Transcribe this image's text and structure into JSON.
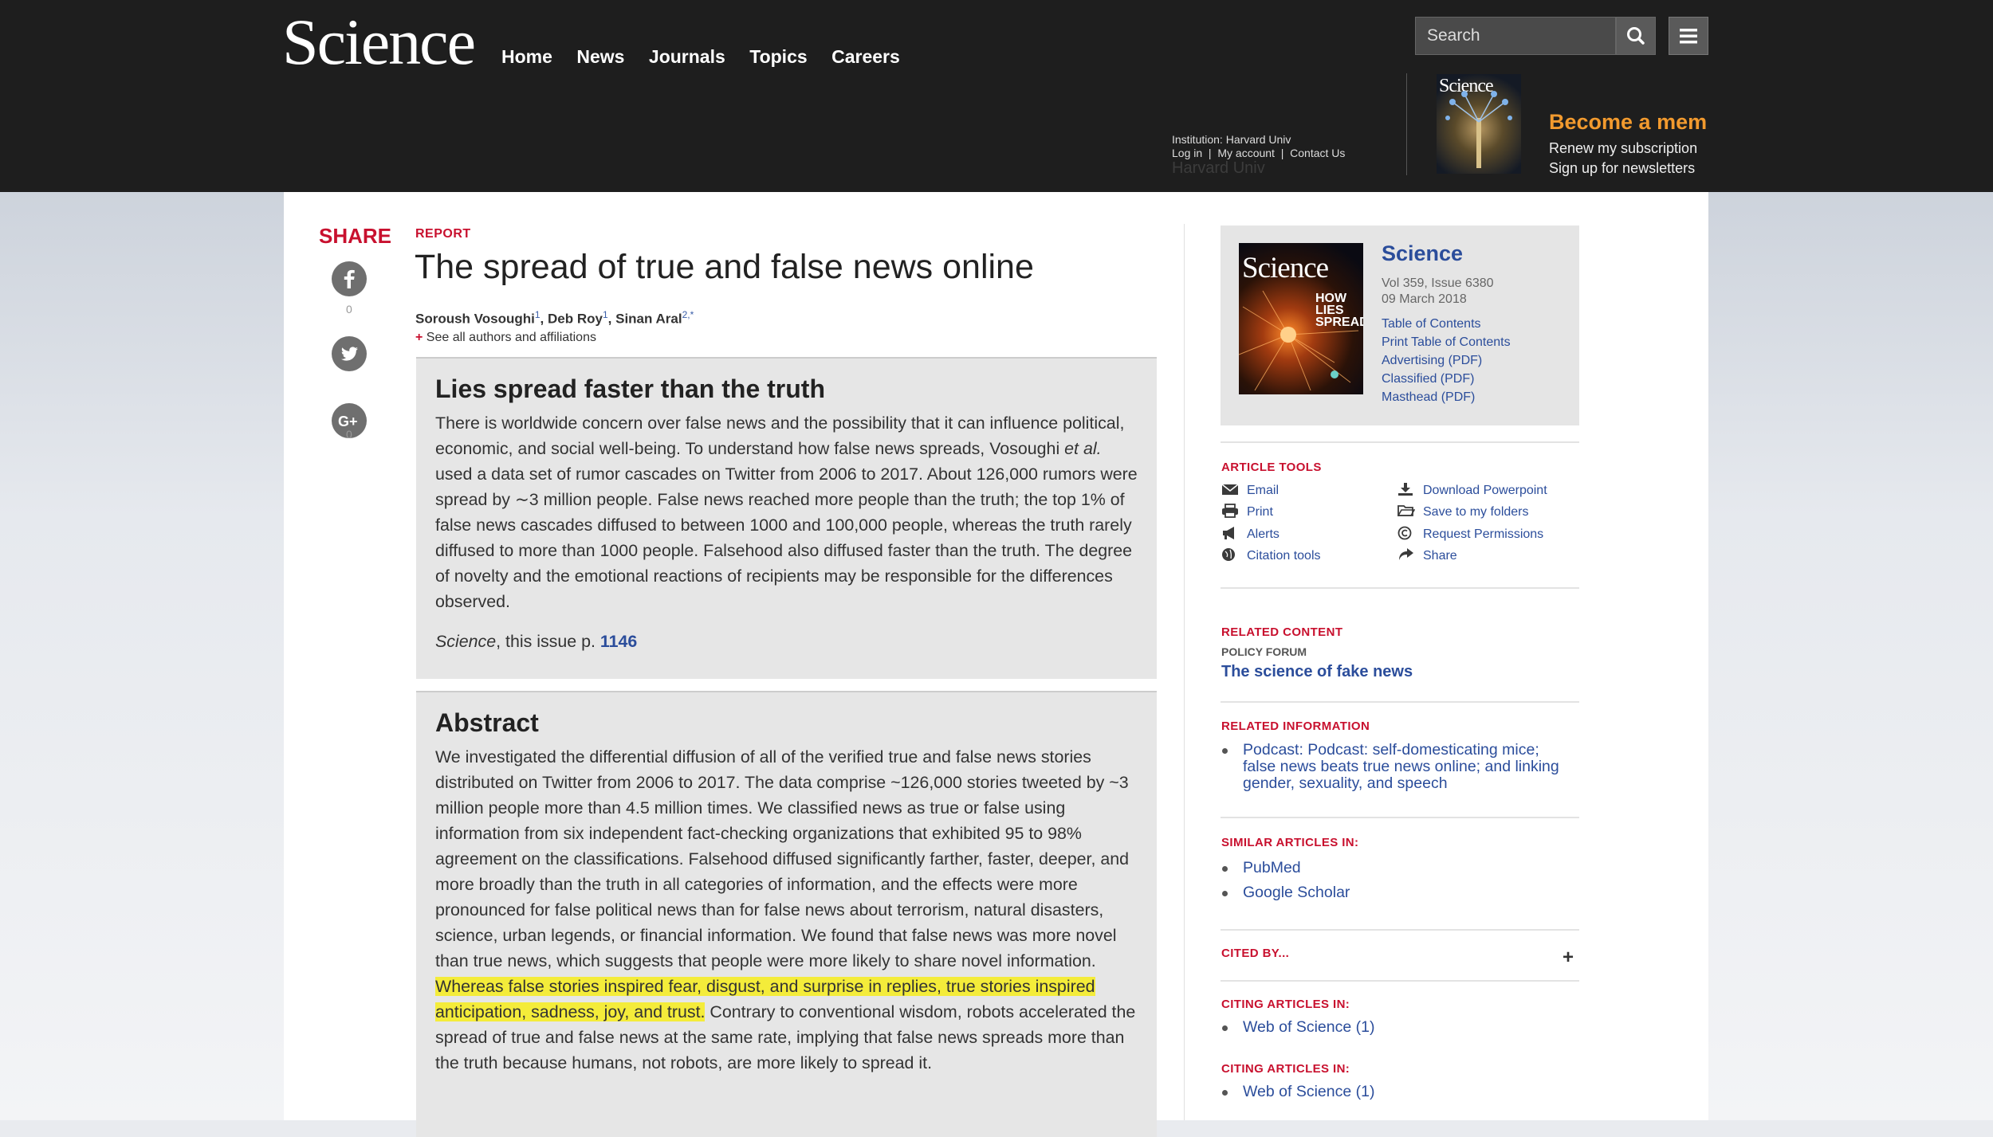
{
  "header": {
    "logo": "Science",
    "nav": [
      "Home",
      "News",
      "Journals",
      "Topics",
      "Careers"
    ],
    "search_placeholder": "Search",
    "institution": "Institution: Harvard Univ",
    "login": "Log in",
    "my_account": "My account",
    "contact": "Contact Us",
    "institution_ghost": "Harvard Univ",
    "mini_cover_title": "Science",
    "become_member": "Become a member",
    "renew": "Renew my subscription",
    "signup": "Sign up for newsletters"
  },
  "share": {
    "label": "SHARE",
    "facebook_count": "0",
    "google_count": "0"
  },
  "article": {
    "type": "REPORT",
    "title": "The spread of true and false news online",
    "authors": [
      {
        "name": "Soroush Vosoughi",
        "sup": "1"
      },
      {
        "name": "Deb Roy",
        "sup": "1"
      },
      {
        "name": "Sinan Aral",
        "sup": "2,*"
      }
    ],
    "see_all": "See all authors and affiliations",
    "editor_summary": {
      "heading": "Lies spread faster than the truth",
      "text_before_italic": "There is worldwide concern over false news and the possibility that it can influence political, economic, and social well-being. To understand how false news spreads, Vosoughi ",
      "italic": "et al.",
      "text_after_italic": " used a data set of rumor cascades on Twitter from 2006 to 2017. About 126,000 rumors were spread by ∼3 million people. False news reached more people than the truth; the top 1% of false news cascades diffused to between 1000 and 100,000 people, whereas the truth rarely diffused to more than 1000 people. Falsehood also diffused faster than the truth. The degree of novelty and the emotional reactions of recipients may be responsible for the differences observed.",
      "ref_journal": "Science",
      "ref_text": ", this issue p. ",
      "ref_page": "1146"
    },
    "abstract": {
      "heading": "Abstract",
      "text_before": "We investigated the differential diffusion of all of the verified true and false news stories distributed on Twitter from 2006 to 2017. The data comprise ~126,000 stories tweeted by ~3 million people more than 4.5 million times. We classified news as true or false using information from six independent fact-checking organizations that exhibited 95 to 98% agreement on the classifications. Falsehood diffused significantly farther, faster, deeper, and more broadly than the truth in all categories of information, and the effects were more pronounced for false political news than for false news about terrorism, natural disasters, science, urban legends, or financial information. We found that false news was more novel than true news, which suggests that people were more likely to share novel information. ",
      "highlighted": "Whereas false stories inspired fear, disgust, and surprise in replies, true stories inspired anticipation, sadness, joy, and trust.",
      "text_after": " Contrary to conventional wisdom, robots accelerated the spread of true and false news at the same rate, implying that false news spreads more than the truth because humans, not robots, are more likely to spread it."
    }
  },
  "sidebar": {
    "issue": {
      "cover_title": "Science",
      "cover_sub": "HOW LIES SPREAD",
      "title": "Science",
      "vol": "Vol 359, Issue 6380",
      "date": "09 March 2018",
      "links": [
        "Table of Contents",
        "Print Table of Contents",
        "Advertising (PDF)",
        "Classified (PDF)",
        "Masthead (PDF)"
      ]
    },
    "article_tools": {
      "heading": "ARTICLE TOOLS",
      "left": [
        "Email",
        "Print",
        "Alerts",
        "Citation tools"
      ],
      "right": [
        "Download Powerpoint",
        "Save to my folders",
        "Request Permissions",
        "Share"
      ]
    },
    "related_content": {
      "heading": "RELATED CONTENT",
      "category": "POLICY FORUM",
      "link": "The science of fake news"
    },
    "related_information": {
      "heading": "RELATED INFORMATION",
      "items": [
        "Podcast: Podcast: self-domesticating mice; false news beats true news online; and linking gender, sexuality, and speech"
      ]
    },
    "similar_articles": {
      "heading": "SIMILAR ARTICLES IN:",
      "items": [
        "PubMed",
        "Google Scholar"
      ]
    },
    "cited_by": {
      "heading": "CITED BY...",
      "toggle": "+"
    },
    "citing_1": {
      "heading": "CITING ARTICLES IN:",
      "items": [
        "Web of Science (1)"
      ]
    },
    "citing_2": {
      "heading": "CITING ARTICLES IN:",
      "items": [
        "Web of Science (1)"
      ]
    }
  },
  "colors": {
    "brand_red": "#c8102e",
    "link_blue": "#2b4d9b",
    "highlight": "#f4ec3a",
    "member_orange": "#f29a2e"
  }
}
